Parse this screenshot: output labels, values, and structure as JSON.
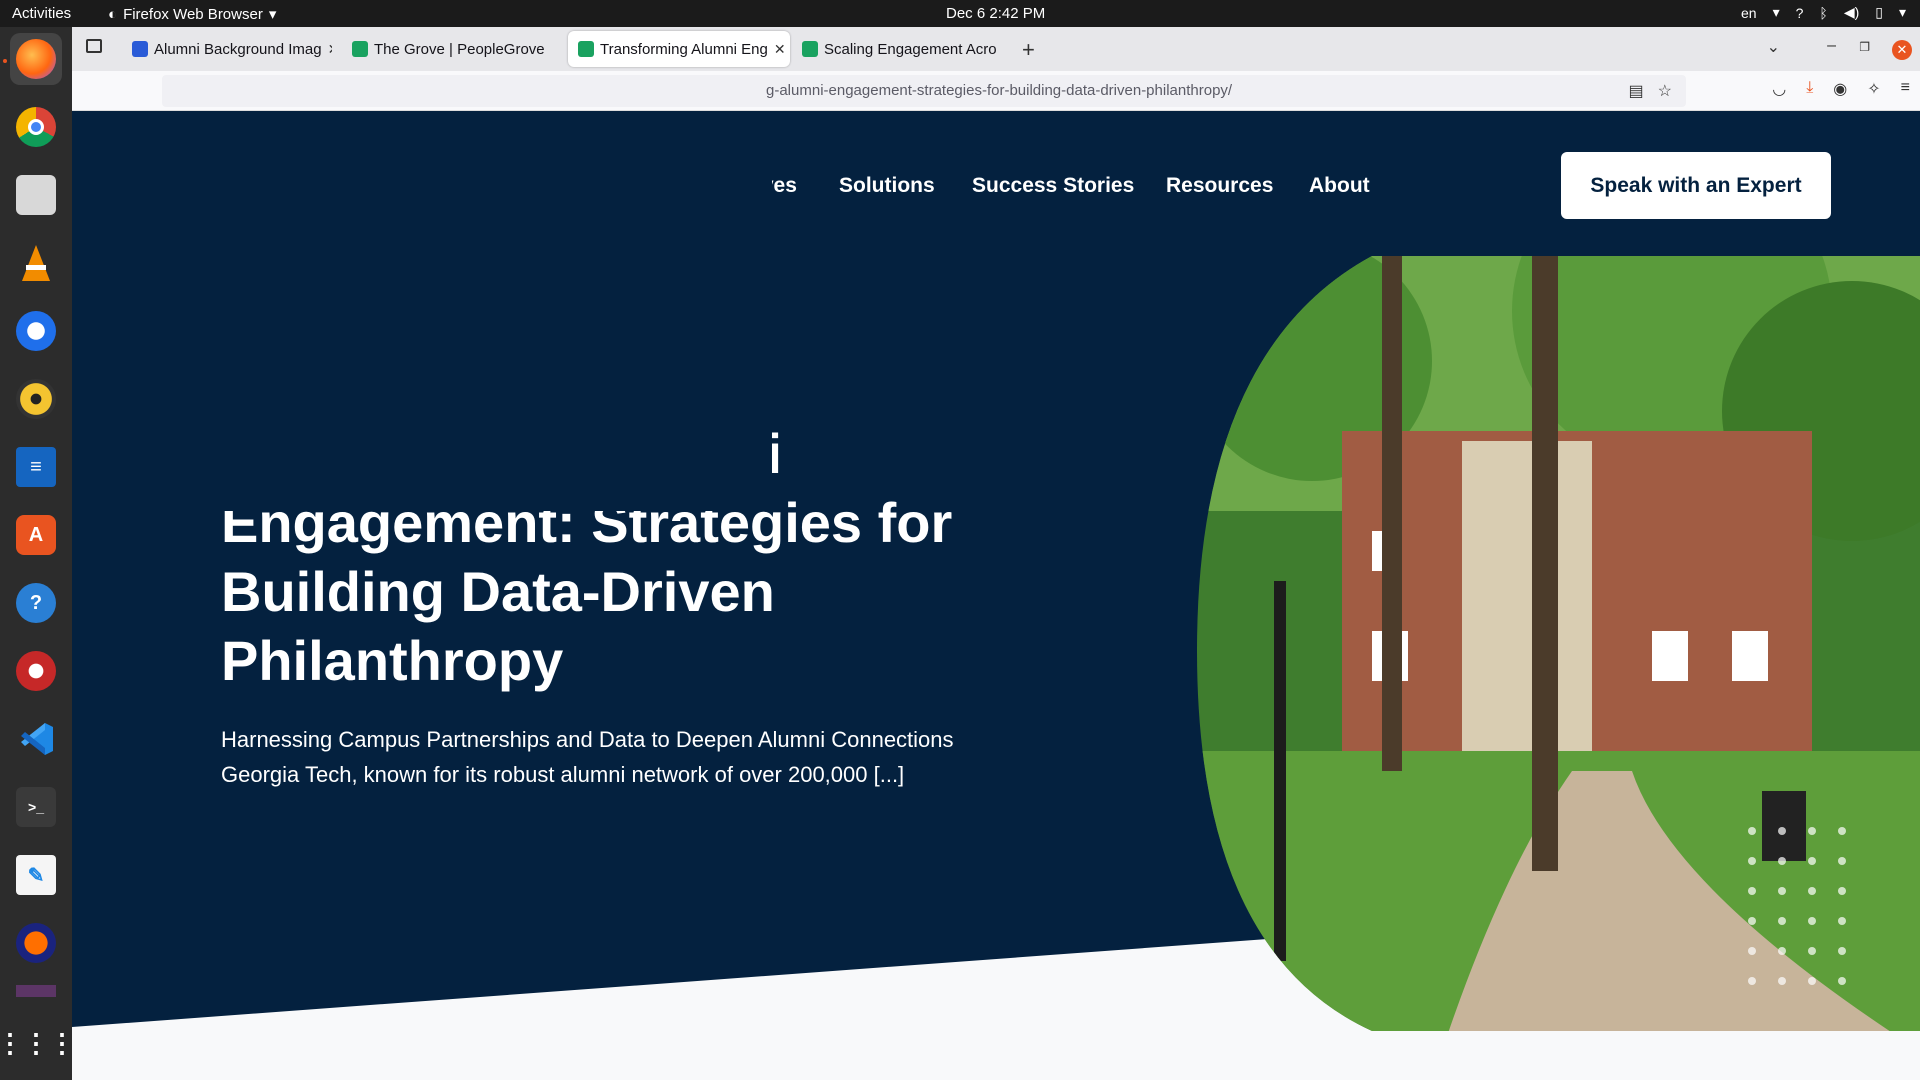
{
  "system_bar": {
    "activities": "Activities",
    "app_name": "Firefox Web Browser",
    "clock": "Dec 6  2:42 PM",
    "input_lang": "en"
  },
  "dock": {
    "apps": [
      "firefox-icon",
      "chrome-icon",
      "files-icon",
      "vlc-icon",
      "thunderbird-icon",
      "rhythmbox-icon",
      "writer-icon",
      "app-center-icon",
      "help-icon",
      "inkscape-icon",
      "vscode-icon",
      "terminal-icon",
      "text-editor-icon",
      "audacity-icon",
      "unknown-app-icon",
      "show-apps-icon"
    ]
  },
  "browser": {
    "tabs": [
      {
        "title": "Alumni Background Imag",
        "active": false,
        "favicon_color": "#2a5bd7"
      },
      {
        "title": "The Grove | PeopleGrove",
        "active": false,
        "favicon_color": "#1aa260"
      },
      {
        "title": "Transforming Alumni Eng",
        "active": true,
        "favicon_color": "#1aa260"
      },
      {
        "title": "Scaling Engagement Acro",
        "active": false,
        "favicon_color": "#1aa260"
      }
    ],
    "url": "g-alumni-engagement-strategies-for-building-data-driven-philanthropy/"
  },
  "site": {
    "nav": [
      "Initiatives",
      "Solutions",
      "Success Stories",
      "Resources",
      "About"
    ],
    "cta": "Speak with an Expert",
    "hero_title": "Transforming Alumni Engagement: Strategies for Building Data-Driven Philanthropy",
    "hero_subtitle": "Harnessing Campus Partnerships and Data to Deepen Alumni Connections Georgia Tech, known for its robust alumni network of over 200,000 [...]",
    "colors": {
      "navy": "#04213f",
      "white": "#ffffff"
    }
  }
}
